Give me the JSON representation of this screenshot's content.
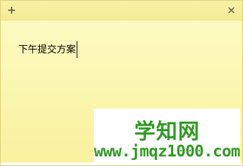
{
  "window": {
    "type": "sticky-note"
  },
  "toolbar": {
    "add_icon": "plus-icon",
    "close_icon": "close-icon"
  },
  "note": {
    "text": "下午提交方案"
  },
  "watermark": {
    "title": "学知网",
    "url": "www.jmqz1000.com"
  },
  "colors": {
    "note_background": "#fcf8b8",
    "title_bar": "#f4eb94",
    "watermark": "#2f9a22"
  }
}
